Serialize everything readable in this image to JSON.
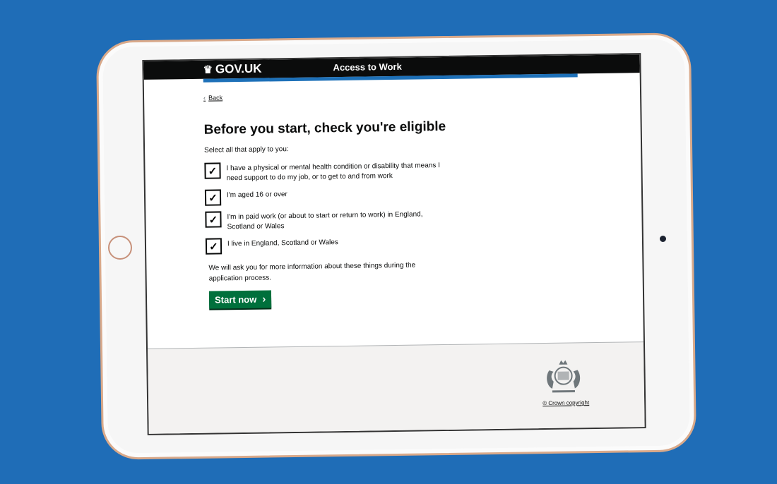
{
  "header": {
    "logo_text": "GOV.UK",
    "service_name": "Access to Work"
  },
  "main": {
    "back_label": "Back",
    "title": "Before you start, check you're eligible",
    "hint": "Select all that apply to you:",
    "options": [
      {
        "label": "I have a physical or mental health condition or disability that means I need support to do my job, or to get to and from work",
        "checked": true
      },
      {
        "label": "I'm aged 16 or over",
        "checked": true
      },
      {
        "label": "I'm in paid work (or about to start or return to work) in England, Scotland or Wales",
        "checked": true
      },
      {
        "label": "I live in England, Scotland or Wales",
        "checked": true
      }
    ],
    "note": "We will ask you for more information about these things during the application process.",
    "start_label": "Start now",
    "check_glyph": "✓"
  },
  "footer": {
    "copyright": "© Crown copyright"
  },
  "colors": {
    "background": "#1f6db7",
    "header": "#0b0c0c",
    "accent_bar": "#1d70b8",
    "start_button": "#00703c",
    "footer": "#f3f2f1"
  },
  "icons": [
    "crown-icon",
    "chevron-left-icon",
    "chevron-right-icon",
    "royal-crest-icon"
  ]
}
